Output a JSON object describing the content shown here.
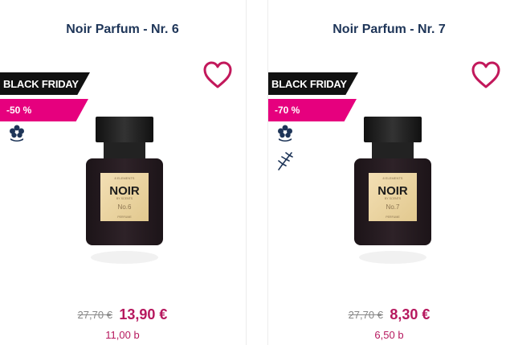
{
  "products": [
    {
      "title": "Noir Parfum - Nr. 6",
      "badge_black_friday": "BLACK FRIDAY",
      "badge_discount": "-50 %",
      "label_brand": "NOIR",
      "label_small_top": "8 ELEMENTS",
      "label_sub": "BY SCENTS",
      "label_number": "No.6",
      "label_type": "PERFUME",
      "old_price": "27,70 €",
      "new_price": "13,90 €",
      "points": "11,00 b"
    },
    {
      "title": "Noir Parfum - Nr. 7",
      "badge_black_friday": "BLACK FRIDAY",
      "badge_discount": "-70 %",
      "label_brand": "NOIR",
      "label_small_top": "8 ELEMENTS",
      "label_sub": "BY SCENTS",
      "label_number": "No.7",
      "label_type": "PERFUME",
      "old_price": "27,70 €",
      "new_price": "8,30 €",
      "points": "6,50 b"
    }
  ],
  "colors": {
    "title": "#1e3558",
    "accent": "#e6007e",
    "price": "#b6185e",
    "heart": "#c2185b",
    "badge_dark": "#111111"
  },
  "icons": {
    "wishlist": "heart-outline-icon",
    "eco": "flower-icon",
    "natural": "sprig-icon"
  }
}
